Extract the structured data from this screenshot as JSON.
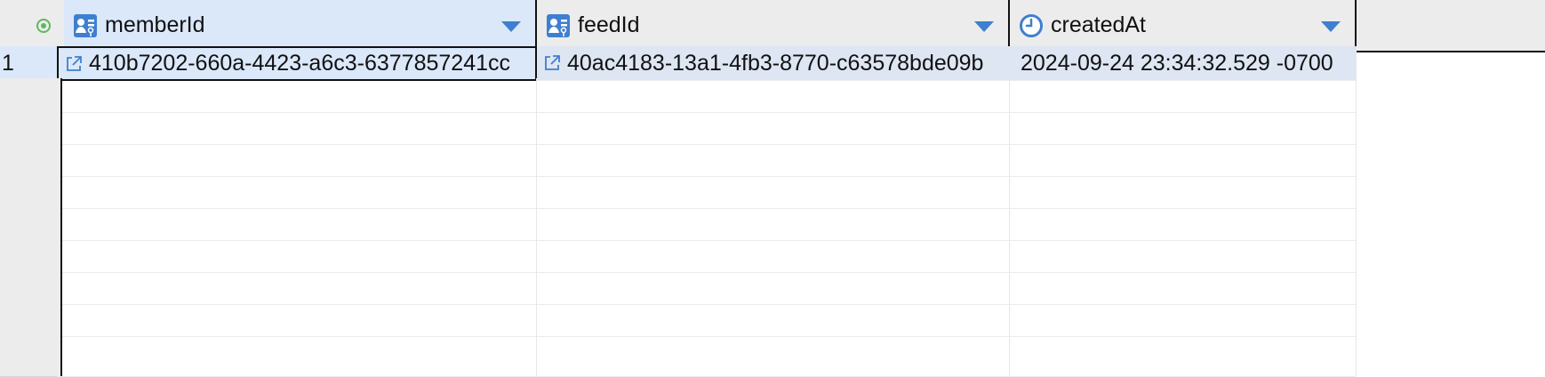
{
  "columns": [
    {
      "name": "memberId",
      "icon": "key-user-icon"
    },
    {
      "name": "feedId",
      "icon": "key-user-icon"
    },
    {
      "name": "createdAt",
      "icon": "clock-icon"
    }
  ],
  "rows": [
    {
      "num": "1",
      "memberId": "410b7202-660a-4423-a6c3-6377857241cc",
      "feedId": "40ac4183-13a1-4fb3-8770-c63578bde09b",
      "createdAt": "2024-09-24 23:34:32.529 -0700"
    }
  ],
  "colors": {
    "header_bg": "#ececec",
    "selected_bg": "#dbe8fa",
    "row_bg": "#dde6f2",
    "accent": "#3f7fcf"
  }
}
